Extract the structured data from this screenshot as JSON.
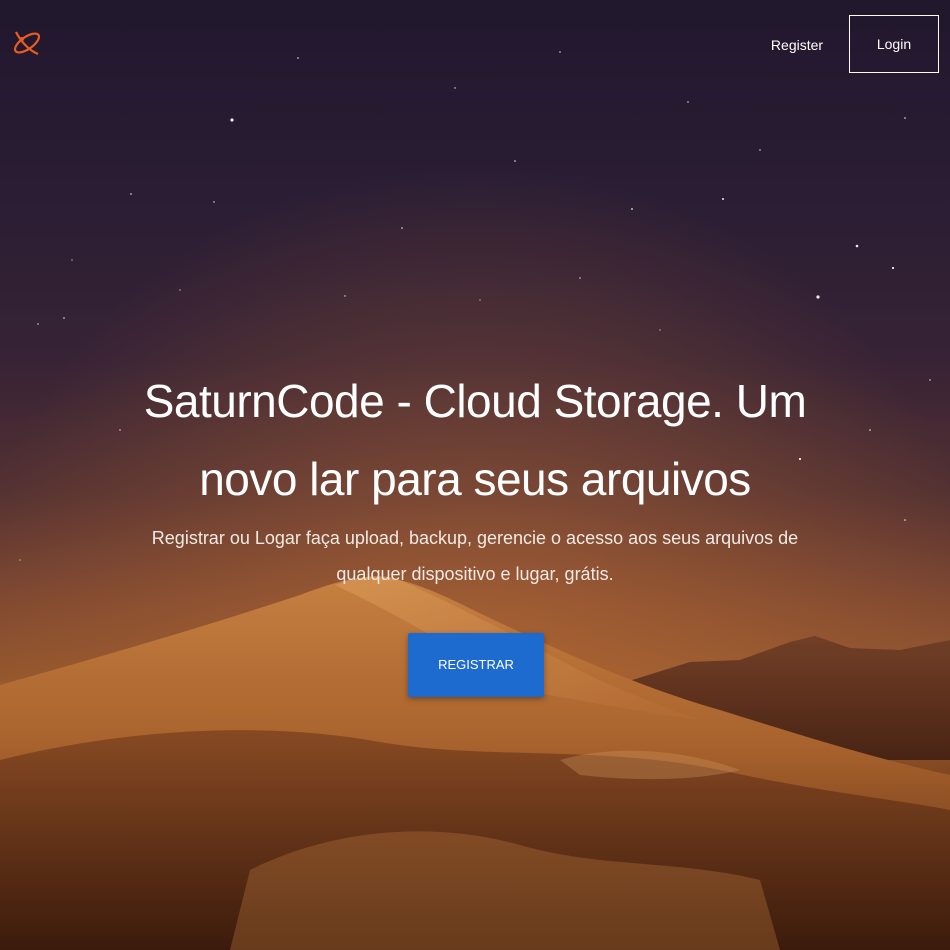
{
  "header": {
    "logo_icon": "saturn-ring-icon",
    "nav": {
      "register_label": "Register",
      "login_label": "Login"
    }
  },
  "hero": {
    "title": "SaturnCode - Cloud Storage. Um novo lar para seus arquivos",
    "subtitle": "Registrar ou Logar faça upload, backup, gerencie o acesso aos seus arquivos de qualquer dispositivo e lugar, grátis.",
    "cta_label": "REGISTRAR"
  },
  "colors": {
    "primary_button": "#1e6bcf",
    "logo_accent": "#e85d20",
    "text": "#ffffff"
  },
  "background": {
    "description_icon": "desert-night-sky-image"
  }
}
